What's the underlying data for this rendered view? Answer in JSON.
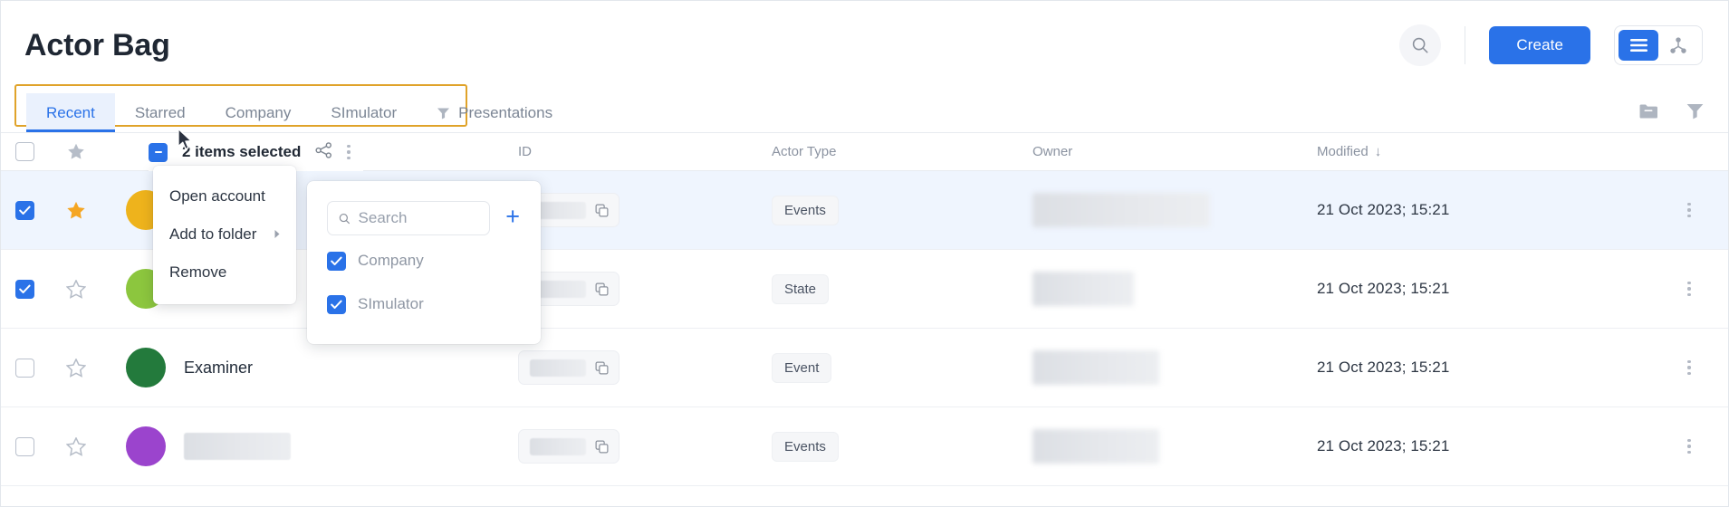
{
  "header": {
    "title": "Actor Bag",
    "search_icon": "search-icon",
    "create_label": "Create",
    "view_list_icon": "list-view-icon",
    "view_graph_icon": "graph-view-icon"
  },
  "tabs": {
    "items": [
      {
        "label": "Recent",
        "icon": null,
        "active": true
      },
      {
        "label": "Starred",
        "icon": null,
        "active": false
      },
      {
        "label": "Company",
        "icon": null,
        "active": false
      },
      {
        "label": "SImulator",
        "icon": null,
        "active": false
      },
      {
        "label": "Presentations",
        "icon": "filter-icon",
        "active": false
      }
    ],
    "right_icons": [
      "folder-icon",
      "filter-icon"
    ]
  },
  "table": {
    "columns": {
      "id": "ID",
      "actor_type": "Actor Type",
      "owner": "Owner",
      "modified": "Modified",
      "sort_indicator": "↓"
    },
    "rows": [
      {
        "checked": true,
        "starred": true,
        "avatar_color": "#eeb31c",
        "name": "",
        "name_redacted": true,
        "id_redacted": true,
        "actor_type": "Events",
        "owner_redacted": true,
        "modified": "21 Oct 2023; 15:21",
        "selected": true
      },
      {
        "checked": true,
        "starred": false,
        "avatar_color": "#8cc63e",
        "name": "",
        "name_redacted": true,
        "id_redacted": true,
        "actor_type": "State",
        "owner_redacted": true,
        "modified": "21 Oct 2023; 15:21",
        "selected": false
      },
      {
        "checked": false,
        "starred": false,
        "avatar_color": "#237a3c",
        "name": "Examiner",
        "name_redacted": false,
        "id_redacted": true,
        "actor_type": "Event",
        "owner_redacted": true,
        "modified": "21 Oct 2023; 15:21",
        "selected": false
      },
      {
        "checked": false,
        "starred": false,
        "avatar_color": "#9b44cd",
        "name": "",
        "name_redacted": true,
        "id_redacted": true,
        "actor_type": "Events",
        "owner_redacted": true,
        "modified": "21 Oct 2023; 15:21",
        "selected": false
      }
    ]
  },
  "selection_toolbar": {
    "count_label": "2 items selected",
    "share_icon": "share-icon",
    "more_icon": "more-vertical-icon",
    "checkbox_state": "indeterminate"
  },
  "context_menu": {
    "items": [
      {
        "label": "Open account",
        "has_submenu": false
      },
      {
        "label": "Add to folder",
        "has_submenu": true
      },
      {
        "label": "Remove",
        "has_submenu": false
      }
    ]
  },
  "folder_submenu": {
    "search_placeholder": "Search",
    "search_value": "",
    "add_icon": "plus-icon",
    "options": [
      {
        "label": "Company",
        "checked": true
      },
      {
        "label": "SImulator",
        "checked": true
      }
    ]
  },
  "colors": {
    "accent": "#2a72e8",
    "highlight_box": "#e0a32a",
    "star_active": "#f5a623",
    "selected_row_bg": "#eff5fe"
  }
}
